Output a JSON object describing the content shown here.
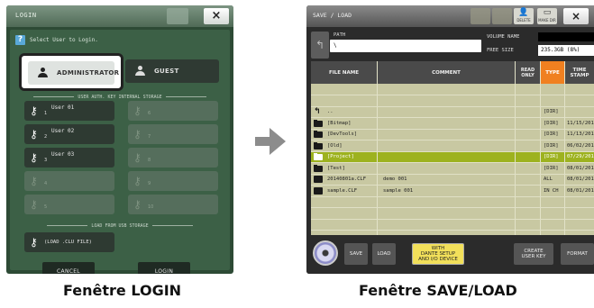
{
  "login": {
    "title": "LOGIN",
    "prompt": "Select User to Login.",
    "admin_label": "ADMINISTRATOR",
    "guest_label": "GUEST",
    "internal_storage_label": "USER AUTH. KEY INTERNAL STORAGE",
    "slots": [
      {
        "num": "1",
        "name": "User 01",
        "filled": true
      },
      {
        "num": "6",
        "name": "",
        "filled": false
      },
      {
        "num": "2",
        "name": "User 02",
        "filled": true
      },
      {
        "num": "7",
        "name": "",
        "filled": false
      },
      {
        "num": "3",
        "name": "User 03",
        "filled": true
      },
      {
        "num": "8",
        "name": "",
        "filled": false
      },
      {
        "num": "4",
        "name": "",
        "filled": false
      },
      {
        "num": "9",
        "name": "",
        "filled": false
      },
      {
        "num": "5",
        "name": "",
        "filled": false
      },
      {
        "num": "10",
        "name": "",
        "filled": false
      }
    ],
    "usb_label": "LOAD FROM USB STORAGE",
    "load_button": "(LOAD .CLU FILE)",
    "cancel": "CANCEL",
    "login": "LOGIN",
    "close": "×"
  },
  "saveload": {
    "title": "SAVE / LOAD",
    "toolbar": {
      "delete": "DELETE",
      "make_dir": "MAKE DIR",
      "close": "×"
    },
    "path_label": "PATH",
    "path_value": "\\",
    "volume_name_label": "VOLUME NAME",
    "free_size_label": "FREE SIZE",
    "free_size_value": "235.3GB (8%)",
    "columns": {
      "file_name": "FILE NAME",
      "comment": "COMMENT",
      "read_only": "READ ONLY",
      "type": "TYPE",
      "time_stamp": "TIME STAMP"
    },
    "rows": [
      {
        "icon": "up",
        "name": "..",
        "comment": "",
        "type": "[DIR]",
        "date": "",
        "time": "",
        "selected": false
      },
      {
        "icon": "folder",
        "name": "[Bitmap]",
        "comment": "",
        "type": "[DIR]",
        "date": "11/15/2013",
        "time": "13:52:32",
        "selected": false
      },
      {
        "icon": "folder",
        "name": "[DevTools]",
        "comment": "",
        "type": "[DIR]",
        "date": "11/13/2013",
        "time": "15:12:59",
        "selected": false
      },
      {
        "icon": "folder",
        "name": "[Old]",
        "comment": "",
        "type": "[DIR]",
        "date": "06/02/2014",
        "time": "17:19:30",
        "selected": false
      },
      {
        "icon": "folder",
        "name": "[Project]",
        "comment": "",
        "type": "[DIR]",
        "date": "07/29/2014",
        "time": "11:46:36",
        "selected": true
      },
      {
        "icon": "folder",
        "name": "[Test]",
        "comment": "",
        "type": "[DIR]",
        "date": "08/01/2014",
        "time": "16:28:44",
        "selected": false
      },
      {
        "icon": "file",
        "name": "20140801a.CLF",
        "comment": "demo 001",
        "type": "ALL",
        "type2": "V1.70",
        "date": "08/01/2014",
        "time": "16:29:20",
        "selected": false
      },
      {
        "icon": "file",
        "name": "sample.CLF",
        "comment": "sample 001",
        "type": "IN CH",
        "type2": "V1.70",
        "date": "08/01/2014",
        "time": "16:29:12",
        "selected": false
      }
    ],
    "buttons": {
      "save": "SAVE",
      "load": "LOAD",
      "dante_l1": "WITH",
      "dante_l2": "DANTE SETUP",
      "dante_l3": "AND I/O DEVICE",
      "create_l1": "CREATE",
      "create_l2": "USER KEY",
      "format": "FORMAT"
    }
  },
  "captions": {
    "left": "Fenêtre LOGIN",
    "right": "Fenêtre SAVE/LOAD"
  }
}
